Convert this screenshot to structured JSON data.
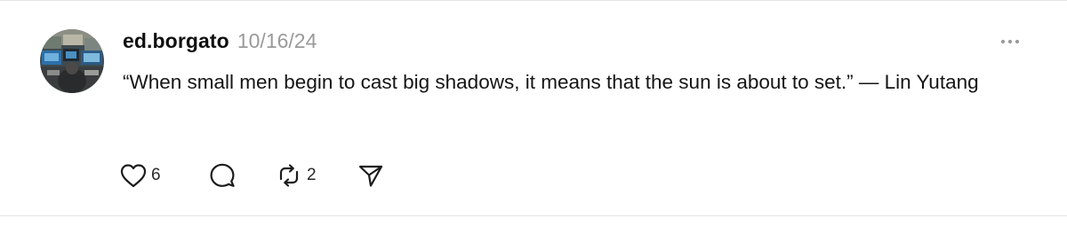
{
  "post": {
    "username": "ed.borgato",
    "timestamp": "10/16/24",
    "text": "“When small men begin to cast big shadows, it means that the sun is about to set.” — Lin Yutang",
    "more_icon": "more-horizontal-icon",
    "actions": {
      "like": {
        "icon": "heart-icon",
        "count": "6"
      },
      "reply": {
        "icon": "comment-icon"
      },
      "repost": {
        "icon": "repost-icon",
        "count": "2"
      },
      "share": {
        "icon": "send-icon"
      }
    }
  }
}
